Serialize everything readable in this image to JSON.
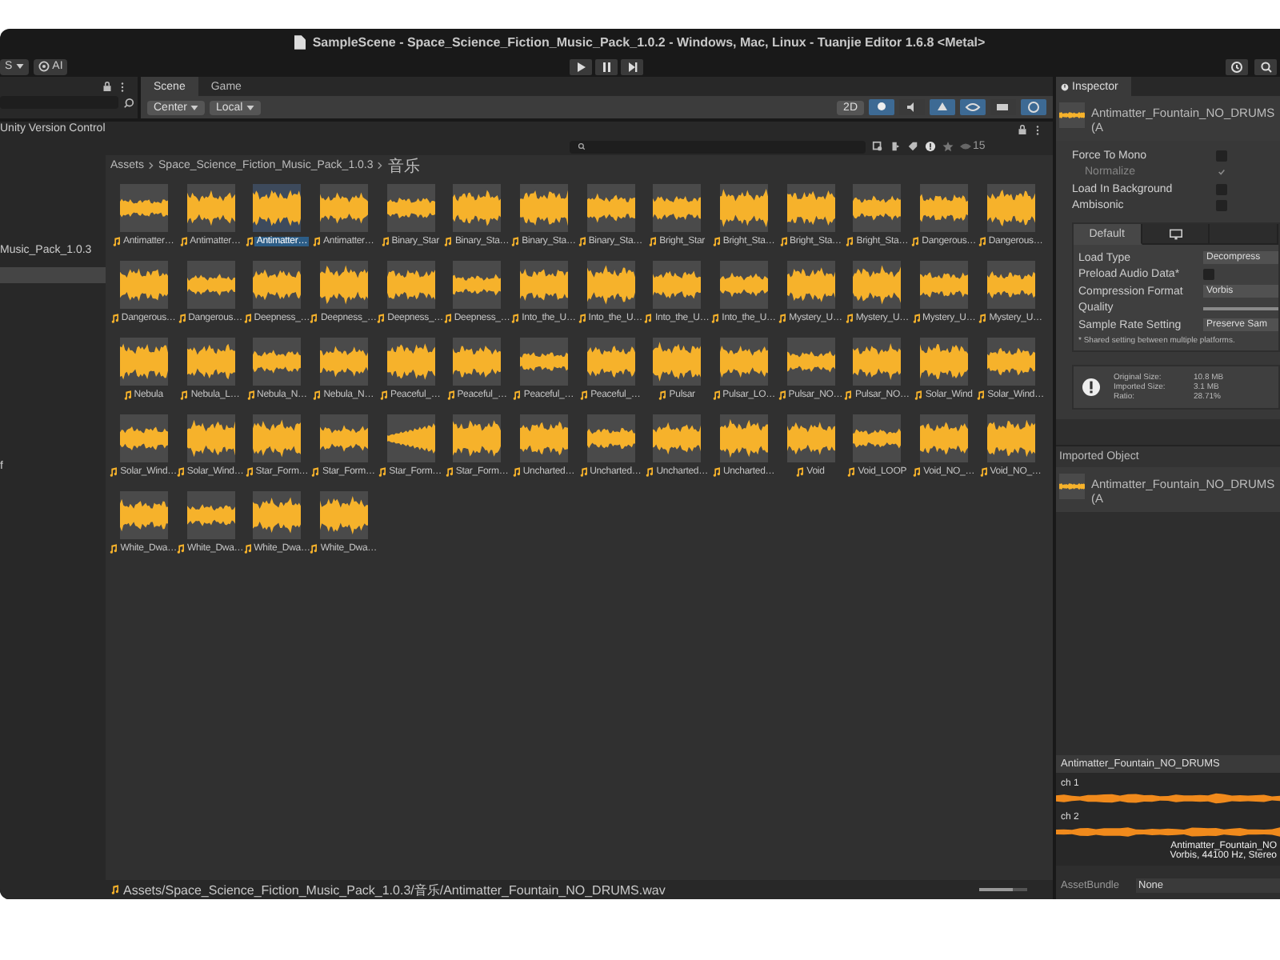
{
  "window": {
    "title": "SampleScene - Space_Science_Fiction_Music_Pack_1.0.2 - Windows, Mac, Linux - Tuanjie Editor 1.6.8 <Metal>"
  },
  "toolbar": {
    "account": "S",
    "ai": "AI"
  },
  "scene_tabs": [
    {
      "label": "Scene",
      "selected": true
    },
    {
      "label": "Game",
      "selected": false
    }
  ],
  "scene_toolbar": {
    "pivot": "Center",
    "space": "Local",
    "mode_2d": "2D",
    "toggles": [
      {
        "kind": "light",
        "on": true
      },
      {
        "kind": "audio",
        "on": false
      },
      {
        "kind": "effects",
        "on": true
      },
      {
        "kind": "visibility",
        "on": true
      },
      {
        "kind": "camera",
        "on": false
      },
      {
        "kind": "gizmos",
        "on": true
      }
    ]
  },
  "project": {
    "tree": [
      {
        "label": "Unity Version Control",
        "selected": false
      },
      {
        "label": "Music_Pack_1.0.3",
        "selected": false
      },
      {
        "selected": true
      },
      {
        "label": "f",
        "selected": false
      }
    ],
    "hidden_count": "15",
    "breadcrumb": [
      "Assets",
      "Space_Science_Fiction_Music_Pack_1.0.3",
      "音乐"
    ],
    "assets": [
      {
        "name": "Antimatter…",
        "selected": false
      },
      {
        "name": "Antimatter…",
        "selected": false
      },
      {
        "name": "Antimatter…",
        "selected": true
      },
      {
        "name": "Antimatter…",
        "selected": false
      },
      {
        "name": "Binary_Star",
        "selected": false
      },
      {
        "name": "Binary_Sta…",
        "selected": false
      },
      {
        "name": "Binary_Sta…",
        "selected": false
      },
      {
        "name": "Binary_Sta…",
        "selected": false
      },
      {
        "name": "Bright_Star",
        "selected": false
      },
      {
        "name": "Bright_Sta…",
        "selected": false
      },
      {
        "name": "Bright_Sta…",
        "selected": false
      },
      {
        "name": "Bright_Sta…",
        "selected": false
      },
      {
        "name": "Dangerous…",
        "selected": false
      },
      {
        "name": "Dangerous…",
        "selected": false
      },
      {
        "name": "Dangerous…",
        "selected": false
      },
      {
        "name": "Dangerous…",
        "selected": false
      },
      {
        "name": "Deepness_…",
        "selected": false
      },
      {
        "name": "Deepness_…",
        "selected": false
      },
      {
        "name": "Deepness_…",
        "selected": false
      },
      {
        "name": "Deepness_…",
        "selected": false
      },
      {
        "name": "Into_the_U…",
        "selected": false
      },
      {
        "name": "Into_the_U…",
        "selected": false
      },
      {
        "name": "Into_the_U…",
        "selected": false
      },
      {
        "name": "Into_the_U…",
        "selected": false
      },
      {
        "name": "Mystery_U…",
        "selected": false
      },
      {
        "name": "Mystery_U…",
        "selected": false
      },
      {
        "name": "Mystery_U…",
        "selected": false
      },
      {
        "name": "Mystery_U…",
        "selected": false
      },
      {
        "name": "Nebula",
        "selected": false
      },
      {
        "name": "Nebula_L…",
        "selected": false
      },
      {
        "name": "Nebula_N…",
        "selected": false
      },
      {
        "name": "Nebula_N…",
        "selected": false
      },
      {
        "name": "Peaceful_…",
        "selected": false
      },
      {
        "name": "Peaceful_…",
        "selected": false
      },
      {
        "name": "Peaceful_…",
        "selected": false
      },
      {
        "name": "Peaceful_…",
        "selected": false
      },
      {
        "name": "Pulsar",
        "selected": false
      },
      {
        "name": "Pulsar_LO…",
        "selected": false
      },
      {
        "name": "Pulsar_NO…",
        "selected": false
      },
      {
        "name": "Pulsar_NO…",
        "selected": false
      },
      {
        "name": "Solar_Wind",
        "selected": false
      },
      {
        "name": "Solar_Wind…",
        "selected": false
      },
      {
        "name": "Solar_Wind…",
        "selected": false
      },
      {
        "name": "Solar_Wind…",
        "selected": false
      },
      {
        "name": "Star_Form…",
        "selected": false
      },
      {
        "name": "Star_Form…",
        "selected": false
      },
      {
        "name": "Star_Form…",
        "selected": false
      },
      {
        "name": "Star_Form…",
        "selected": false
      },
      {
        "name": "Uncharted…",
        "selected": false
      },
      {
        "name": "Uncharted…",
        "selected": false
      },
      {
        "name": "Uncharted…",
        "selected": false
      },
      {
        "name": "Uncharted…",
        "selected": false
      },
      {
        "name": "Void",
        "selected": false
      },
      {
        "name": "Void_LOOP",
        "selected": false
      },
      {
        "name": "Void_NO_…",
        "selected": false
      },
      {
        "name": "Void_NO_…",
        "selected": false
      },
      {
        "name": "White_Dwa…",
        "selected": false
      },
      {
        "name": "White_Dwa…",
        "selected": false
      },
      {
        "name": "White_Dwa…",
        "selected": false
      },
      {
        "name": "White_Dwa…",
        "selected": false
      }
    ],
    "path": "Assets/Space_Science_Fiction_Music_Pack_1.0.3/音乐/Antimatter_Fountain_NO_DRUMS.wav",
    "icon_size": {
      "level": 0.7
    }
  },
  "inspector": {
    "tab": "Inspector",
    "asset_title": "Antimatter_Fountain_NO_DRUMS (A",
    "toggles": [
      {
        "label": "Force To Mono",
        "checked": false,
        "disabled": false
      },
      {
        "label": "Normalize",
        "checked": true,
        "disabled": true
      },
      {
        "label": "Load In Background",
        "checked": false,
        "disabled": false
      },
      {
        "label": "Ambisonic",
        "checked": false,
        "disabled": false
      }
    ],
    "platform_tabs": [
      {
        "kind": "text",
        "label": "Default",
        "selected": true
      },
      {
        "kind": "monitor",
        "selected": false
      },
      {
        "kind": "blank",
        "selected": false
      }
    ],
    "settings": [
      {
        "kind": "dropdown",
        "label": "Load Type",
        "value": "Decompress"
      },
      {
        "kind": "checkbox",
        "label": "Preload Audio Data*",
        "checked": false
      },
      {
        "kind": "dropdown",
        "label": "Compression Format",
        "value": "Vorbis"
      },
      {
        "kind": "slider",
        "label": "Quality",
        "level": 1
      },
      {
        "kind": "dropdown",
        "label": "Sample Rate Setting",
        "value": "Preserve Sam"
      }
    ],
    "note": "* Shared setting between multiple platforms.",
    "info": [
      {
        "label": "Original Size:",
        "value": "10.8 MB"
      },
      {
        "label": "Imported Size:",
        "value": "3.1 MB"
      },
      {
        "label": "Ratio:",
        "value": "28.71%"
      }
    ],
    "imported_object": {
      "header": "Imported Object",
      "name": "Antimatter_Fountain_NO_DRUMS (A"
    },
    "preview": {
      "title": "Antimatter_Fountain_NO_DRUMS",
      "channels": [
        "ch 1",
        "ch 2"
      ],
      "caption_name": "Antimatter_Fountain_NO",
      "caption_format": "Vorbis, 44100 Hz, Stereo"
    },
    "asset_bundle": {
      "label": "AssetBundle",
      "value": "None"
    }
  }
}
